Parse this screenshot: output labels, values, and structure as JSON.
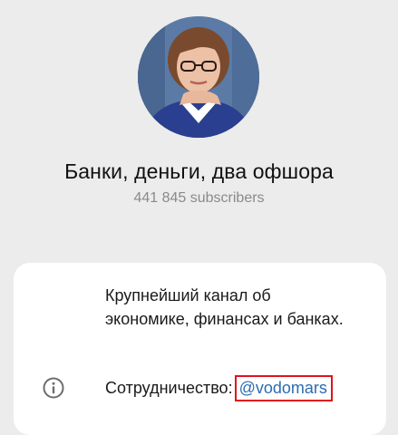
{
  "channel": {
    "title": "Банки, деньги, два офшора",
    "subscribers": "441 845 subscribers",
    "avatar_icon": "channel-avatar-photo"
  },
  "info": {
    "description": "Крупнейший канал об экономике, финансах и банках.",
    "contact_label": "Сотрудничество:",
    "contact_handle": "@vodomars",
    "info_icon": "info-circle-icon"
  },
  "colors": {
    "background": "#ececec",
    "card": "#ffffff",
    "link": "#2b6db0",
    "highlight": "#e0121b"
  }
}
